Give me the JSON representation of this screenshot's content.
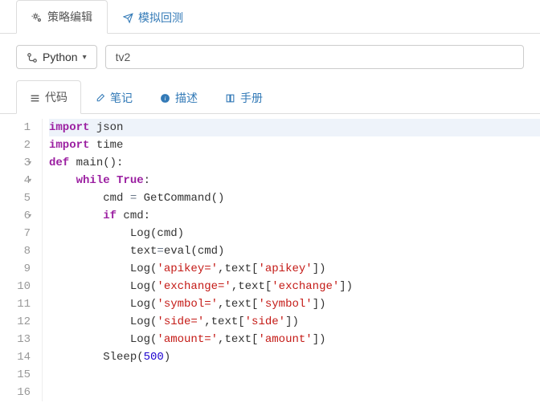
{
  "top_tabs": {
    "edit": "策略编辑",
    "backtest": "模拟回测"
  },
  "toolbar": {
    "language": "Python",
    "name_value": "tv2"
  },
  "sub_tabs": {
    "code": "代码",
    "notes": "笔记",
    "desc": "描述",
    "manual": "手册"
  },
  "gutter": {
    "l1": "1",
    "l2": "2",
    "l3": "3",
    "l4": "4",
    "l5": "5",
    "l6": "6",
    "l7": "7",
    "l8": "8",
    "l9": "9",
    "l10": "10",
    "l11": "11",
    "l12": "12",
    "l13": "13",
    "l14": "14",
    "l15": "15",
    "l16": "16"
  },
  "code": {
    "l1a": "import",
    "l1b": " json",
    "l2a": "import",
    "l2b": " time",
    "l3a": "def",
    "l3b": " ",
    "l3c": "main",
    "l3d": "():",
    "l4a": "    ",
    "l4b": "while",
    "l4c": " ",
    "l4d": "True",
    "l4e": ":",
    "l5a": "        cmd ",
    "l5b": "=",
    "l5c": " GetCommand()",
    "l6a": "        ",
    "l6b": "if",
    "l6c": " cmd:",
    "l7a": "            Log(cmd)",
    "l8a": "            text",
    "l8b": "=",
    "l8c": "eval(cmd)",
    "l9a": "            Log(",
    "l9b": "'apikey='",
    "l9c": ",text[",
    "l9d": "'apikey'",
    "l9e": "])",
    "l10a": "            Log(",
    "l10b": "'exchange='",
    "l10c": ",text[",
    "l10d": "'exchange'",
    "l10e": "])",
    "l11a": "            Log(",
    "l11b": "'symbol='",
    "l11c": ",text[",
    "l11d": "'symbol'",
    "l11e": "])",
    "l12a": "            Log(",
    "l12b": "'side='",
    "l12c": ",text[",
    "l12d": "'side'",
    "l12e": "])",
    "l13a": "            Log(",
    "l13b": "'amount='",
    "l13c": ",text[",
    "l13d": "'amount'",
    "l13e": "])",
    "l14a": "        Sleep(",
    "l14b": "500",
    "l14c": ")"
  }
}
